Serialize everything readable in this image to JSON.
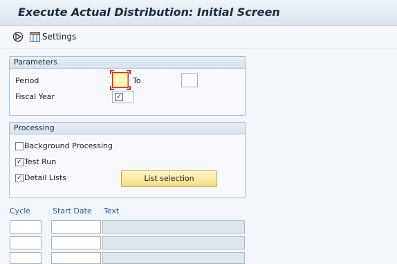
{
  "window": {
    "title": "Execute Actual Distribution: Initial Screen"
  },
  "toolbar": {
    "execute_icon": "execute-icon",
    "settings_label": "Settings"
  },
  "parameters": {
    "title": "Parameters",
    "period_label": "Period",
    "to_label": "To",
    "fiscal_year_label": "Fiscal Year",
    "period_value": "",
    "to_value": "",
    "fiscal_year_value": ""
  },
  "processing": {
    "title": "Processing",
    "background_label": "Background Processing",
    "background_checked": false,
    "test_run_label": "Test Run",
    "test_run_checked": true,
    "detail_lists_label": "Detail Lists",
    "detail_lists_checked": true,
    "list_selection_label": "List selection"
  },
  "table": {
    "headers": [
      "Cycle",
      "Start Date",
      "Text"
    ],
    "rows": [
      [
        "",
        "",
        ""
      ],
      [
        "",
        "",
        ""
      ],
      [
        "",
        "",
        ""
      ]
    ]
  },
  "colors": {
    "header_link": "#2456a8",
    "required_field": "#fff6bd",
    "group_border": "#a9bfd6"
  }
}
